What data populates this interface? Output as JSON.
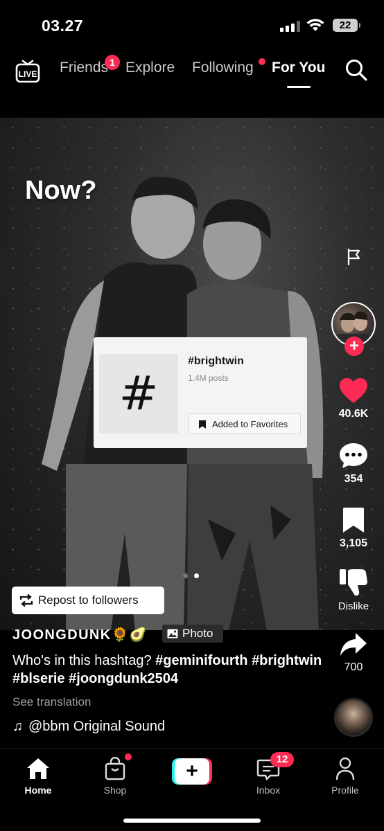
{
  "status_bar": {
    "time": "03.27",
    "battery": "22"
  },
  "top_nav": {
    "live_label": "LIVE",
    "tabs": [
      {
        "label": "Friends",
        "badge": "1"
      },
      {
        "label": "Explore"
      },
      {
        "label": "Following",
        "dot": true
      },
      {
        "label": "For You",
        "active": true
      }
    ]
  },
  "post": {
    "overlay_text": "Now?",
    "hashtag_card": {
      "symbol": "#",
      "name": "#brightwin",
      "posts": "1.4M posts",
      "favorite_label": "Added to Favorites"
    },
    "repost_label": "Repost to followers",
    "author": "JOONGDUNK🌻🥑",
    "type_chip": "Photo",
    "caption_text": "Who's in this hashtag? ",
    "caption_tags": [
      "#geminifourth",
      "#brightwin",
      "#blserie",
      "#joongdunk2504"
    ],
    "see_translation": "See translation",
    "sound": "@bbm Original Sound",
    "pager": {
      "count": 2,
      "current": 2
    }
  },
  "rail": {
    "likes": "40.6K",
    "comments": "354",
    "favorites": "3,105",
    "dislike_label": "Dislike",
    "shares": "700",
    "follow_symbol": "+"
  },
  "tab_bar": {
    "home": "Home",
    "shop": "Shop",
    "create_symbol": "+",
    "inbox": "Inbox",
    "inbox_badge": "12",
    "profile": "Profile"
  },
  "colors": {
    "accent": "#fe2c55",
    "cyan": "#25f4ee",
    "background": "#000000"
  }
}
